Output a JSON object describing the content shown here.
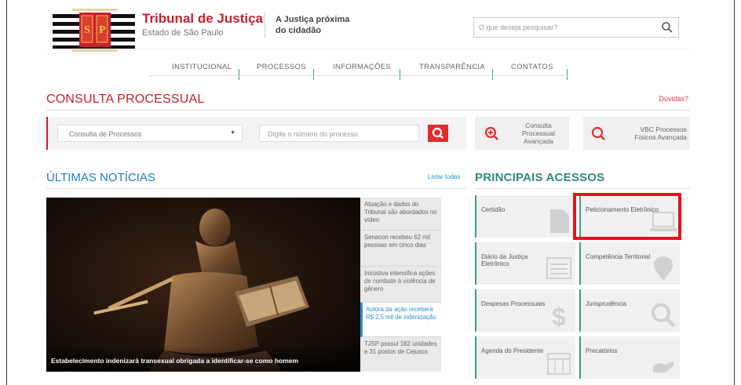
{
  "header": {
    "title": "Tribunal de Justiça",
    "subtitle": "Estado de São Paulo",
    "slogan_line1": "A Justiça próxima",
    "slogan_line2": "do cidadão",
    "search_placeholder": "O que deseja pesquisar?"
  },
  "nav": [
    "INSTITUCIONAL",
    "PROCESSOS",
    "INFORMAÇÕES",
    "TRANSPARÊNCIA",
    "CONTATOS"
  ],
  "consulta": {
    "title": "CONSULTA PROCESSUAL",
    "help": "Dúvidas?",
    "select_value": "Consulta de Processos",
    "number_placeholder": "Digite o número do processo",
    "advanced1_l1": "Consulta",
    "advanced1_l2": "Processual",
    "advanced1_l3": "Avançada",
    "advanced2_l1": "VBC Processos",
    "advanced2_l2": "Físicos Avançada"
  },
  "news": {
    "title": "ÚLTIMAS NOTÍCIAS",
    "list_all": "Listar todas",
    "caption": "Estabelecimento indenizará transexual obrigada a identificar-se como homem",
    "items": [
      "Atuação e dados do Tribunal são abordados no vídeo",
      "Senacon recebeu 62 mil pessoas em cinco dias",
      "Iniciativa intensifica ações de combate à violência de gênero",
      "Autora da ação receberá R$ 2,5 mil de indenização",
      "TJSP possui 182 unidades e 31 postos de Cejuscs"
    ]
  },
  "access": {
    "title": "PRINCIPAIS ACESSOS",
    "tiles": [
      "Certidão",
      "Peticionamento Eletrônico",
      "Diário da Justiça Eletrônico",
      "Competência Territorial",
      "Despesas Processuais",
      "Jurisprudência",
      "Agenda do Presidente",
      "Precatórios"
    ]
  },
  "colors": {
    "brand_red": "#c8202f",
    "accent_teal": "#3a9c8e",
    "link_blue": "#1f7fb5",
    "highlight": "#e8111b"
  }
}
